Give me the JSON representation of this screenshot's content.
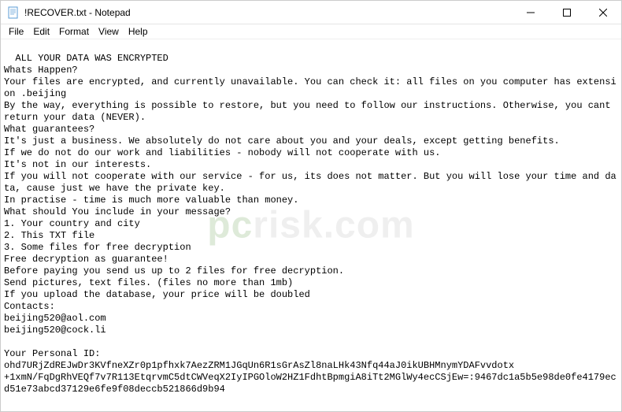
{
  "window": {
    "title": "!RECOVER.txt - Notepad"
  },
  "menu": {
    "file": "File",
    "edit": "Edit",
    "format": "Format",
    "view": "View",
    "help": "Help"
  },
  "body": {
    "text": "ALL YOUR DATA WAS ENCRYPTED\nWhats Happen?\nYour files are encrypted, and currently unavailable. You can check it: all files on you computer has extension .beijing\nBy the way, everything is possible to restore, but you need to follow our instructions. Otherwise, you cant return your data (NEVER).\nWhat guarantees?\nIt's just a business. We absolutely do not care about you and your deals, except getting benefits.\nIf we do not do our work and liabilities - nobody will not cooperate with us.\nIt's not in our interests.\nIf you will not cooperate with our service - for us, its does not matter. But you will lose your time and data, cause just we have the private key.\nIn practise - time is much more valuable than money.\nWhat should You include in your message?\n1. Your country and city\n2. This TXT file\n3. Some files for free decryption\nFree decryption as guarantee!\nBefore paying you send us up to 2 files for free decryption.\nSend pictures, text files. (files no more than 1mb)\nIf you upload the database, your price will be doubled\nContacts:\nbeijing520@aol.com\nbeijing520@cock.li\n\nYour Personal ID:\nohd7URjZdREJwDr3KVfneXZr0p1pfhxk7AezZRM1JGqUn6R1sGrAsZl8naLHk43Nfq44aJ0ikUBHMnymYDAFvvdotx\n+1xmN/FqDgRhVEQf7v7R113EtqrvmC5dtCWVeqX2IyIPGOloW2HZ1FdhtBpmgiA8iTt2MGlWy4ecCSjEw=:9467dc1a5b5e98de0fe4179ecd51e73abcd37129e6fe9f08deccb521866d9b94"
  },
  "watermark": {
    "prefix": "pc",
    "suffix": "risk.com"
  }
}
